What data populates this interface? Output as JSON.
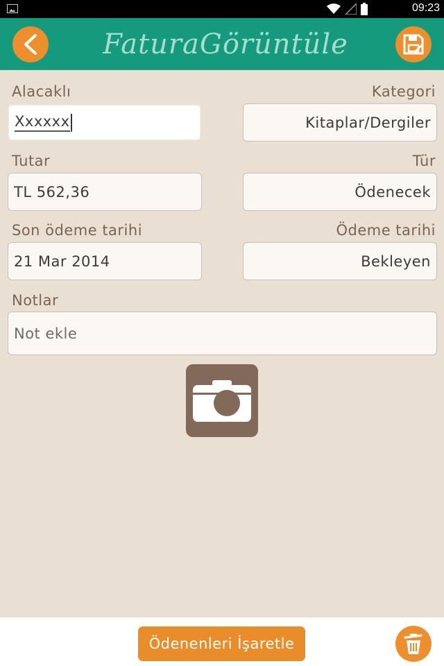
{
  "status_bar": {
    "time": "09:23"
  },
  "header": {
    "title": "FaturaGörüntüle"
  },
  "form": {
    "payee": {
      "label": "Alacaklı",
      "value": "Xxxxxx"
    },
    "category": {
      "label": "Kategori",
      "value": "Kitaplar/Dergiler"
    },
    "amount": {
      "label": "Tutar",
      "value": "TL 562,36"
    },
    "type": {
      "label": "Tür",
      "value": "Ödenecek"
    },
    "due_date": {
      "label": "Son ödeme tarihi",
      "value": "21 Mar 2014"
    },
    "payment_date": {
      "label": "Ödeme tarihi",
      "value": "Bekleyen"
    },
    "notes": {
      "label": "Notlar",
      "placeholder": "Not ekle"
    }
  },
  "actions": {
    "mark_paid_label": "Ödenenleri İşaretle"
  },
  "colors": {
    "accent": "#169a7e",
    "button": "#ec8f2c",
    "background": "#e9dfd3",
    "label": "#7a6456",
    "camera": "#826a5b"
  }
}
